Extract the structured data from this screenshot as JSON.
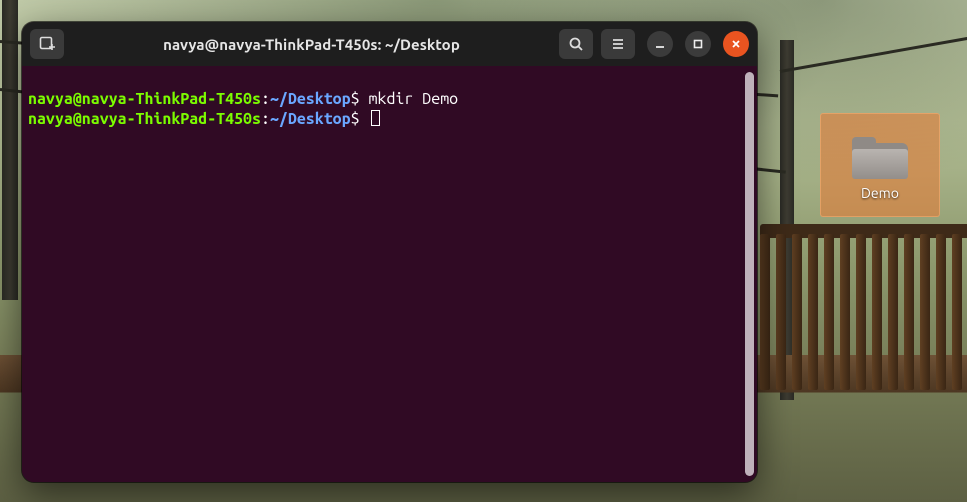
{
  "window": {
    "title": "navya@navya-ThinkPad-T450s: ~/Desktop"
  },
  "prompt": {
    "user": "navya",
    "at": "@",
    "host": "navya-ThinkPad-T450s",
    "sep": ":",
    "path": "~/Desktop",
    "dollar": "$"
  },
  "terminal": {
    "line1_command": " mkdir Demo",
    "line2_command": " "
  },
  "desktop": {
    "folder_label": "Demo"
  }
}
